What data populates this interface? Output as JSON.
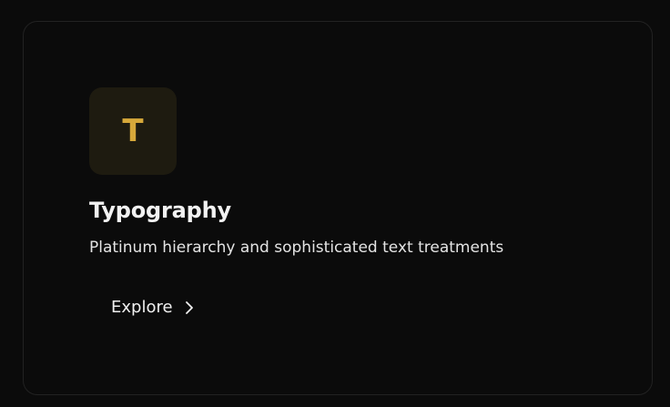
{
  "card": {
    "icon": {
      "name": "letter-t-icon",
      "glyph": "T",
      "color": "#d6a83a",
      "background": "#1e1b10"
    },
    "title": "Typography",
    "subtitle": "Platinum hierarchy and sophisticated text treatments",
    "action": {
      "label": "Explore",
      "icon": "chevron-right-icon"
    }
  },
  "colors": {
    "page_background": "#0b0b0b",
    "card_border": "#222222",
    "text_primary": "#f2f2f2",
    "accent_gold": "#d6a83a"
  }
}
